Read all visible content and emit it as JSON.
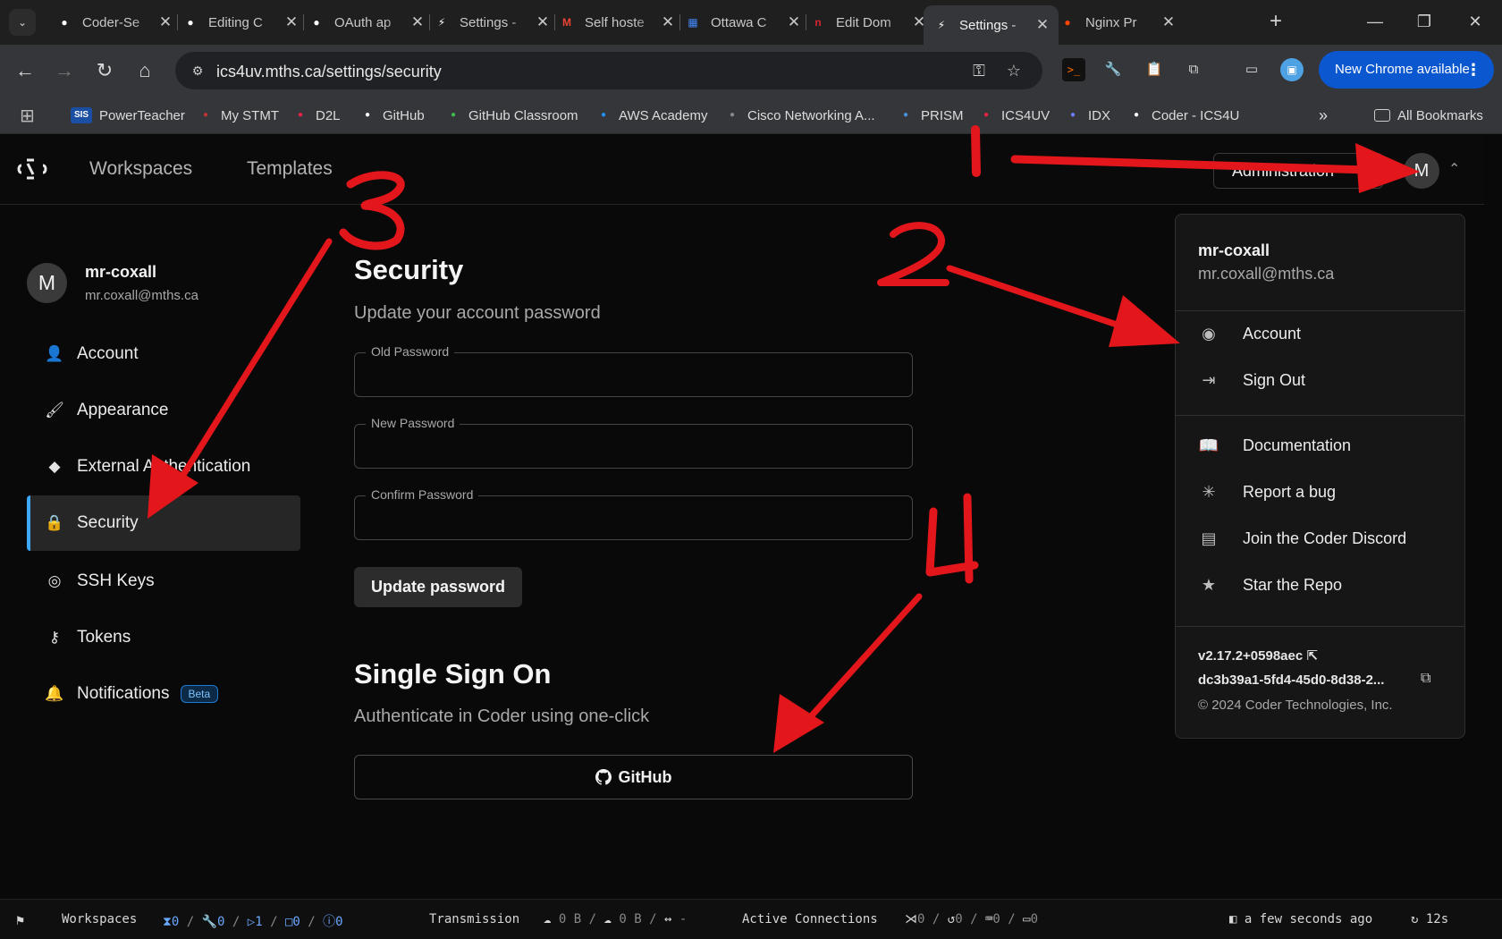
{
  "browser": {
    "tabs": [
      {
        "title": "Coder-Se",
        "favicon": "github-icon",
        "color": "#ffffff"
      },
      {
        "title": "Editing C",
        "favicon": "github-icon",
        "color": "#ffffff"
      },
      {
        "title": "OAuth ap",
        "favicon": "github-icon",
        "color": "#ffffff"
      },
      {
        "title": "Settings -",
        "favicon": "coder-icon",
        "color": "#ffffff"
      },
      {
        "title": "Self hoste",
        "favicon": "gmail-icon",
        "color": "#ea4335"
      },
      {
        "title": "Ottawa C",
        "favicon": "calendar-icon",
        "color": "#4285f4"
      },
      {
        "title": "Edit Dom",
        "favicon": "namecheap-icon",
        "color": "#d9232d"
      },
      {
        "title": "Settings -",
        "favicon": "coder-icon",
        "color": "#ffffff"
      },
      {
        "title": "Nginx Pr",
        "favicon": "reddit-icon",
        "color": "#ff4500"
      }
    ],
    "url": "ics4uv.mths.ca/settings/security",
    "update_label": "New Chrome available",
    "bookmarks": [
      {
        "label": "PowerTeacher",
        "badge": "SIS",
        "color": "#1a4fa3"
      },
      {
        "label": "My STMT",
        "badge": "",
        "color": "#b33"
      },
      {
        "label": "D2L",
        "badge": "",
        "color": "#e24"
      },
      {
        "label": "GitHub",
        "badge": "",
        "color": "#fff"
      },
      {
        "label": "GitHub Classroom",
        "badge": "",
        "color": "#3fb950"
      },
      {
        "label": "AWS Academy",
        "badge": "",
        "color": "#1e90ff"
      },
      {
        "label": "Cisco Networking A...",
        "badge": "",
        "color": "#888"
      },
      {
        "label": "PRISM",
        "badge": "",
        "color": "#4a90d9"
      },
      {
        "label": "ICS4UV",
        "badge": "",
        "color": "#e24"
      },
      {
        "label": "IDX",
        "badge": "",
        "color": "#6f7dff"
      },
      {
        "label": "Coder - ICS4U",
        "badge": "",
        "color": "#fff"
      }
    ],
    "all_bookmarks": "All Bookmarks"
  },
  "coder": {
    "nav": {
      "workspaces": "Workspaces",
      "templates": "Templates",
      "admin": "Administration"
    },
    "user": {
      "initial": "M",
      "name": "mr-coxall",
      "email": "mr.coxall@mths.ca"
    },
    "sidebar": [
      {
        "label": "Account",
        "icon": "person-icon",
        "glyph": "👤"
      },
      {
        "label": "Appearance",
        "icon": "brush-icon",
        "glyph": "🖌"
      },
      {
        "label": "External Authentication",
        "icon": "git-icon",
        "glyph": "◆"
      },
      {
        "label": "Security",
        "icon": "lock-icon",
        "glyph": "🔒"
      },
      {
        "label": "SSH Keys",
        "icon": "fingerprint-icon",
        "glyph": "◎"
      },
      {
        "label": "Tokens",
        "icon": "key-icon",
        "glyph": "⚷"
      },
      {
        "label": "Notifications",
        "icon": "bell-icon",
        "glyph": "🔔",
        "badge": "Beta"
      }
    ],
    "security": {
      "title": "Security",
      "subtitle": "Update your account password",
      "old_label": "Old Password",
      "new_label": "New Password",
      "confirm_label": "Confirm Password",
      "submit": "Update password"
    },
    "sso": {
      "title": "Single Sign On",
      "subtitle": "Authenticate in Coder using one-click",
      "github": "GitHub"
    },
    "menu": {
      "items_a": [
        {
          "label": "Account",
          "icon": "account-circle-icon",
          "glyph": "◉"
        },
        {
          "label": "Sign Out",
          "icon": "logout-icon",
          "glyph": "⇥"
        }
      ],
      "items_b": [
        {
          "label": "Documentation",
          "icon": "book-icon",
          "glyph": "📖"
        },
        {
          "label": "Report a bug",
          "icon": "bug-icon",
          "glyph": "✳"
        },
        {
          "label": "Join the Coder Discord",
          "icon": "chat-icon",
          "glyph": "▤"
        },
        {
          "label": "Star the Repo",
          "icon": "star-icon",
          "glyph": "★"
        }
      ],
      "version": "v2.17.2+0598aec",
      "build_id": "dc3b39a1-5fd4-45d0-8d38-2...",
      "copyright": "© 2024 Coder Technologies, Inc."
    },
    "statusbar": {
      "workspaces": "Workspaces",
      "ws_counts": [
        "0",
        "0",
        "1",
        "0",
        "0"
      ],
      "transmission": "Transmission",
      "tx": [
        "0 B",
        "0 B",
        "-"
      ],
      "active": "Active Connections",
      "conn_counts": [
        "0",
        "0",
        "0",
        "0"
      ],
      "updated": "a few seconds ago",
      "refresh": "12s"
    }
  },
  "annotations": [
    "1",
    "2",
    "3",
    "4"
  ],
  "colors": {
    "accent": "#3ea8ff",
    "annotation": "#e3161b",
    "chrome_update": "#0b57d0"
  }
}
